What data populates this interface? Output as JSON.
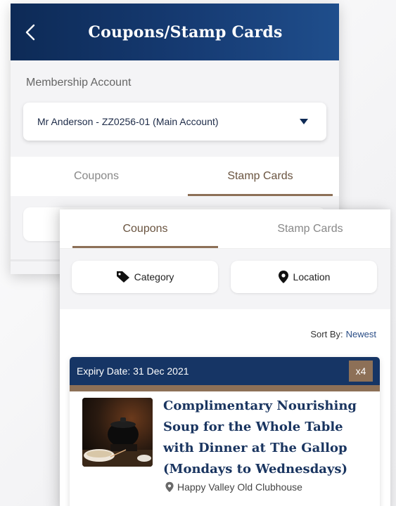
{
  "header": {
    "title": "Coupons/Stamp Cards"
  },
  "membership": {
    "label": "Membership Account",
    "selected": "Mr Anderson - ZZ0256-01 (Main Account)"
  },
  "tabs": {
    "coupons": "Coupons",
    "stamp_cards": "Stamp Cards"
  },
  "filters": {
    "category": "Category",
    "location": "Location"
  },
  "sort": {
    "label": "Sort By:",
    "value": "Newest"
  },
  "coupon": {
    "expiry": "Expiry Date: 31 Dec 2021",
    "quantity": "x4",
    "title": "Complimentary Nourishing Soup for the Whole Table with Dinner at The Gallop (Mondays to Wednesdays)",
    "location": "Happy Valley Old Clubhouse"
  },
  "colors": {
    "header_navy": "#163565",
    "accent_brown": "#8d7057",
    "link_blue": "#2a4d86"
  }
}
